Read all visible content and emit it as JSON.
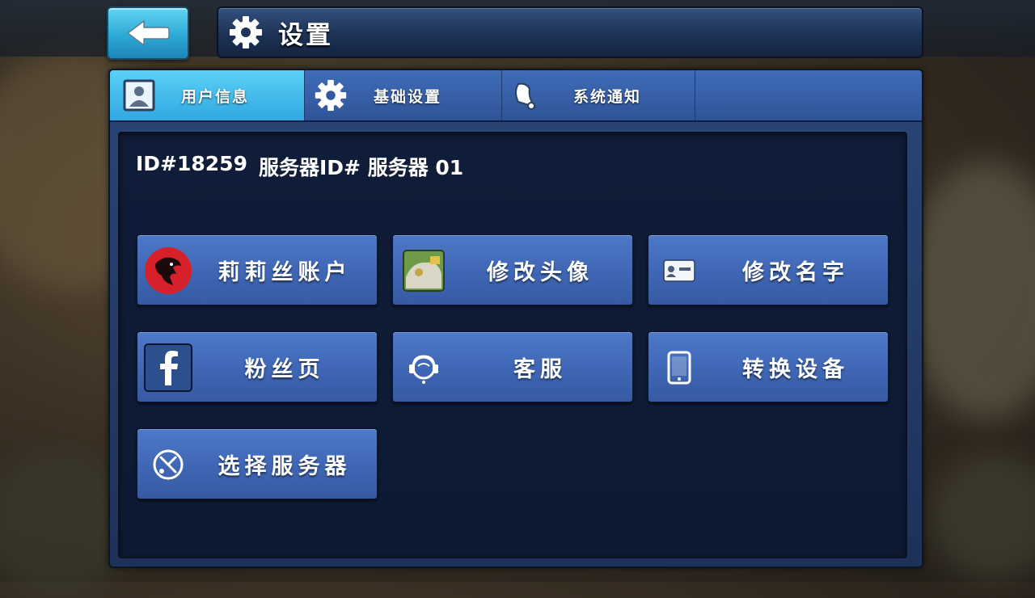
{
  "header": {
    "title": "设置"
  },
  "tabs": [
    {
      "label": "用户信息",
      "icon": "user-profile-icon",
      "active": true
    },
    {
      "label": "基础设置",
      "icon": "gear-icon",
      "active": false
    },
    {
      "label": "系统通知",
      "icon": "bell-icon",
      "active": false
    }
  ],
  "user_info": {
    "id_text": "ID#18259",
    "server_text": "服务器ID# 服务器 01"
  },
  "buttons": {
    "lily_account": {
      "label": "莉莉丝账户",
      "icon": "lilith-logo-icon"
    },
    "change_avatar": {
      "label": "修改头像",
      "icon": "avatar-icon"
    },
    "change_name": {
      "label": "修改名字",
      "icon": "id-card-icon"
    },
    "fan_page": {
      "label": "粉丝页",
      "icon": "facebook-icon"
    },
    "customer_service": {
      "label": "客服",
      "icon": "headset-icon"
    },
    "switch_device": {
      "label": "转换设备",
      "icon": "phone-icon"
    },
    "select_server": {
      "label": "选择服务器",
      "icon": "server-select-icon"
    }
  },
  "colors": {
    "tab_active": "#3fb8ec",
    "button_blue": "#4670bf",
    "panel_dark": "#0f1c36"
  }
}
